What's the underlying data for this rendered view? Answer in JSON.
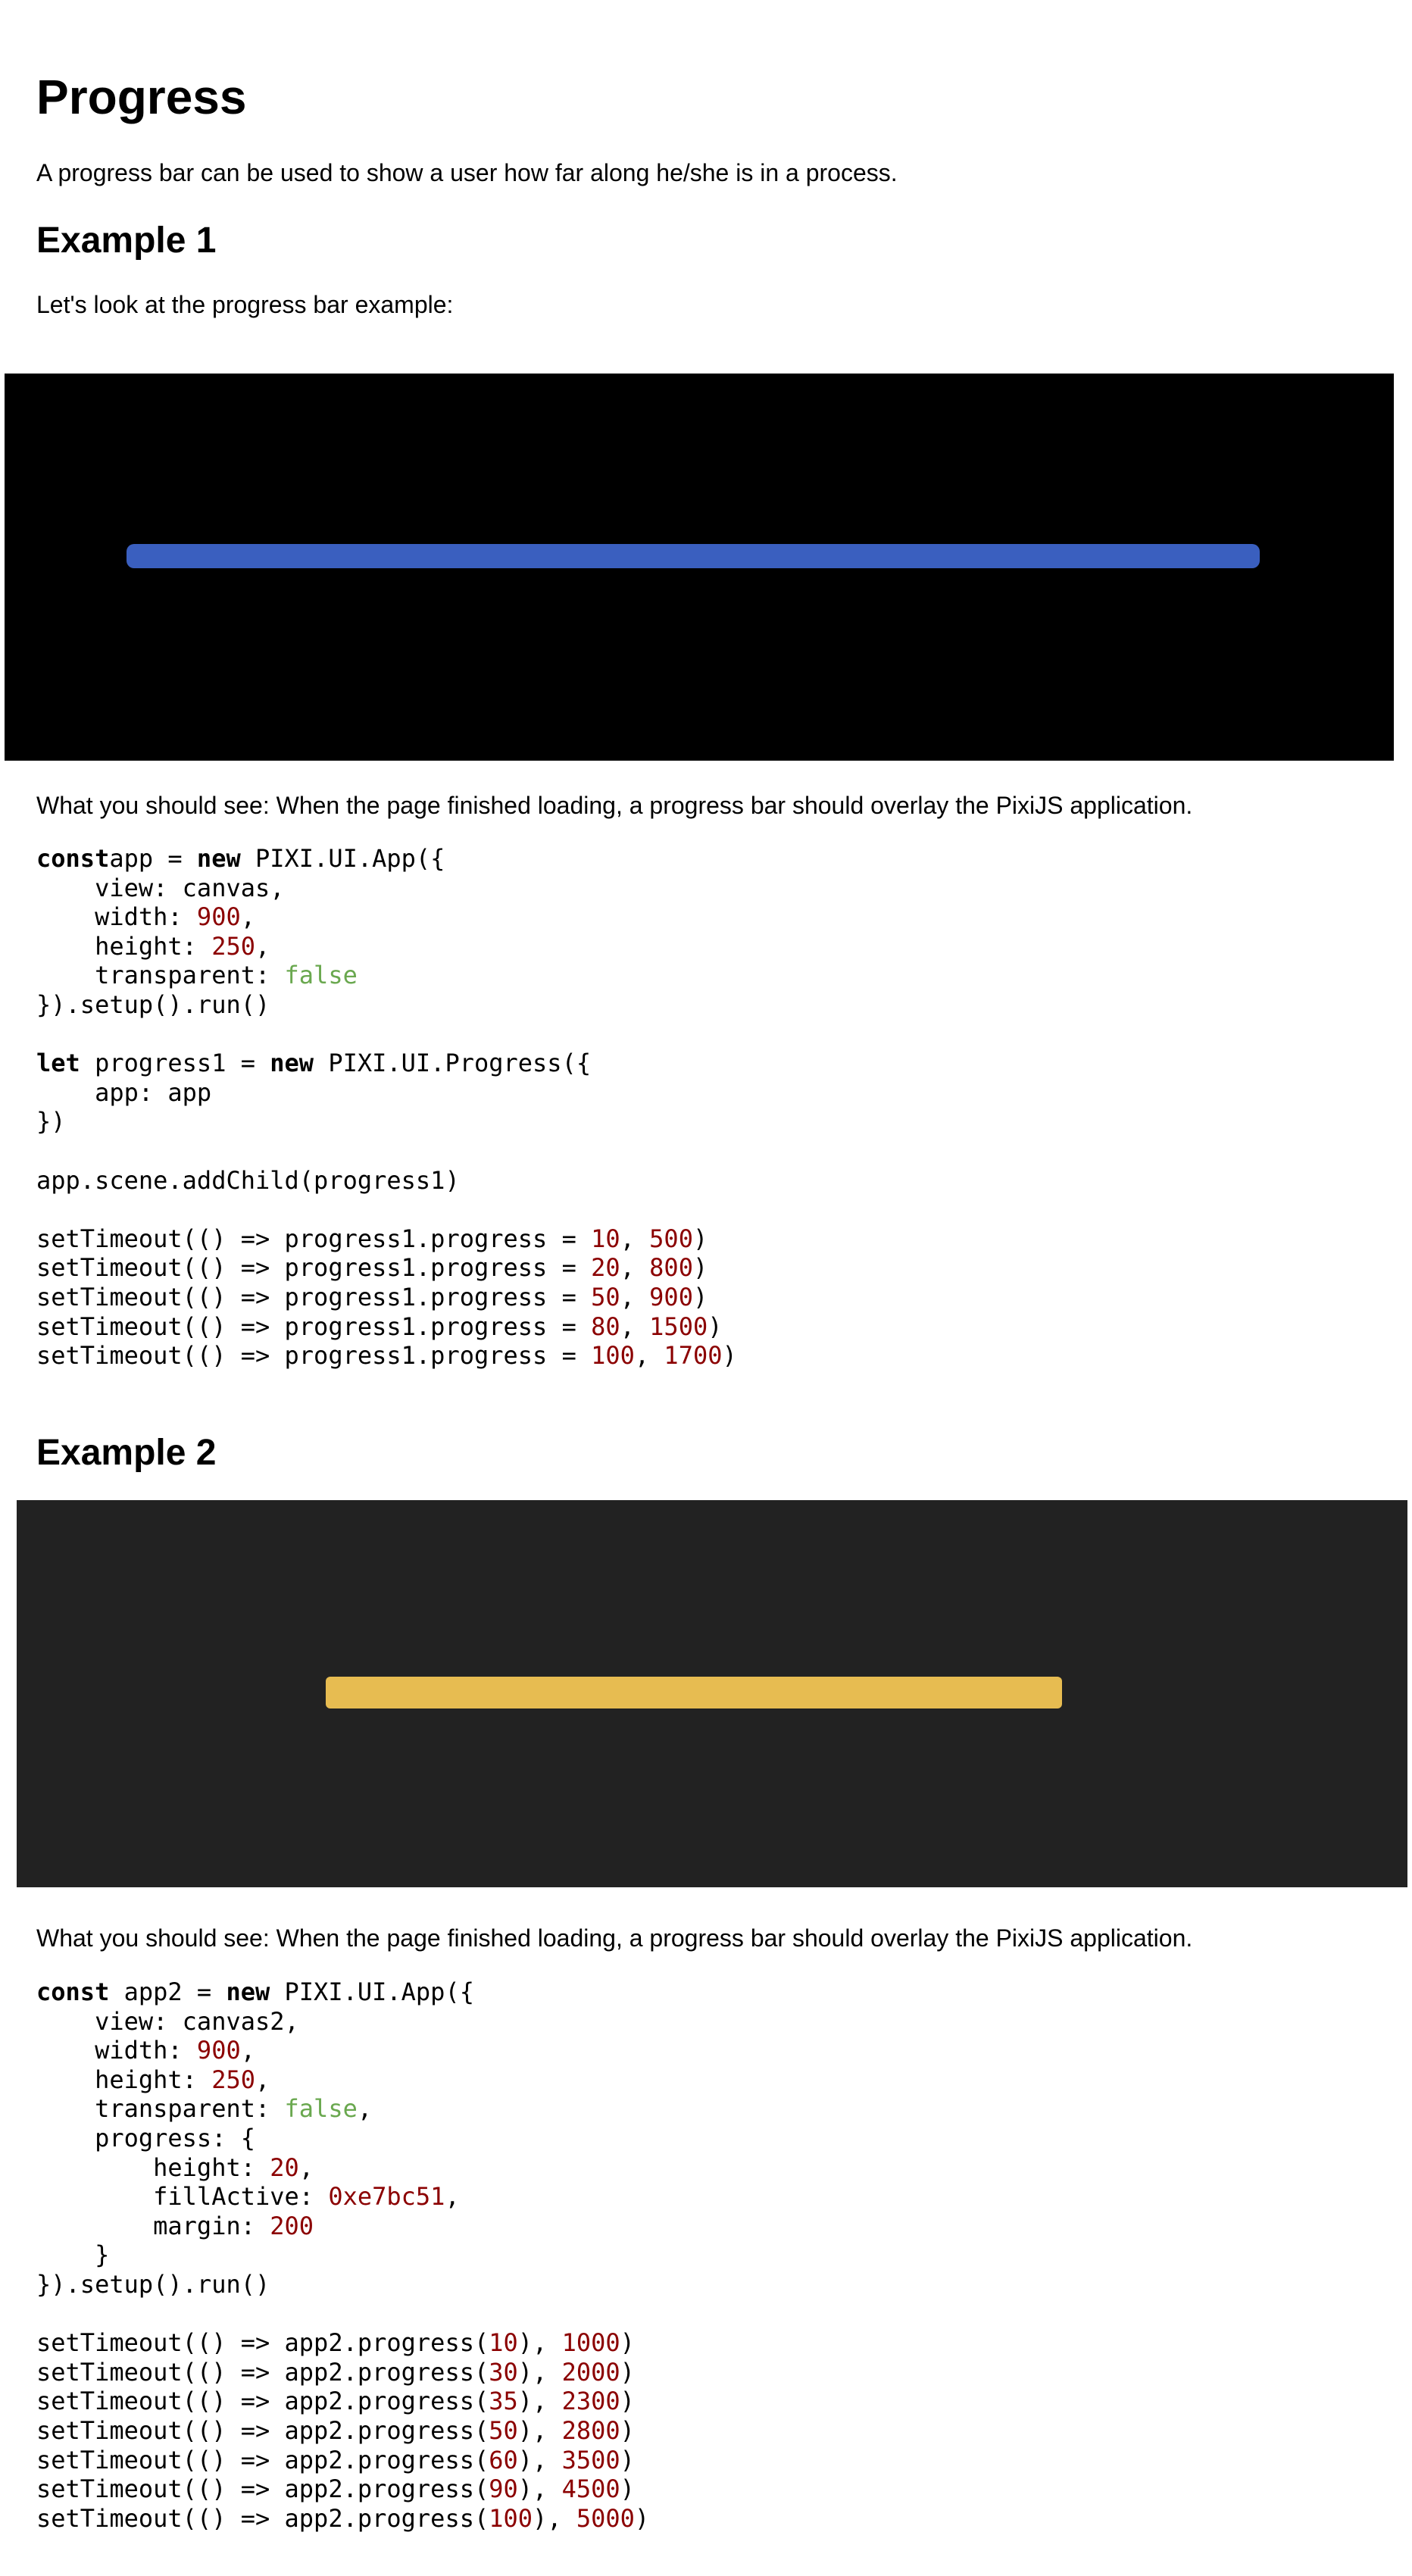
{
  "title": "Progress",
  "intro": "A progress bar can be used to show a user how far along he/she is in a process.",
  "example1": {
    "heading": "Example 1",
    "lead": "Let's look at the progress bar example:",
    "canvas": {
      "background": "#000000",
      "fill_color": "#3a5fbf",
      "progress": 100
    },
    "caption": "What you should see: When the page finished loading, a progress bar should overlay the PixiJS application.",
    "code": [
      [
        [
          "kw",
          "const"
        ],
        [
          "",
          "app = "
        ],
        [
          "kw",
          "new"
        ],
        [
          "",
          " PIXI.UI.App({"
        ]
      ],
      [
        [
          "",
          "    view: canvas,"
        ]
      ],
      [
        [
          "",
          "    width: "
        ],
        [
          "num",
          "900"
        ],
        [
          "",
          ","
        ]
      ],
      [
        [
          "",
          "    height: "
        ],
        [
          "num",
          "250"
        ],
        [
          "",
          ","
        ]
      ],
      [
        [
          "",
          "    transparent: "
        ],
        [
          "bool",
          "false"
        ]
      ],
      [
        [
          "",
          "}).setup().run()"
        ]
      ],
      [
        [
          "",
          ""
        ]
      ],
      [
        [
          "kw",
          "let"
        ],
        [
          "",
          " progress1 = "
        ],
        [
          "kw",
          "new"
        ],
        [
          "",
          " PIXI.UI.Progress({"
        ]
      ],
      [
        [
          "",
          "    app: app"
        ]
      ],
      [
        [
          "",
          "})"
        ]
      ],
      [
        [
          "",
          ""
        ]
      ],
      [
        [
          "",
          "app.scene.addChild(progress1)"
        ]
      ],
      [
        [
          "",
          ""
        ]
      ],
      [
        [
          "",
          "setTimeout(() => progress1.progress = "
        ],
        [
          "num",
          "10"
        ],
        [
          "",
          ", "
        ],
        [
          "num",
          "500"
        ],
        [
          "",
          ")"
        ]
      ],
      [
        [
          "",
          "setTimeout(() => progress1.progress = "
        ],
        [
          "num",
          "20"
        ],
        [
          "",
          ", "
        ],
        [
          "num",
          "800"
        ],
        [
          "",
          ")"
        ]
      ],
      [
        [
          "",
          "setTimeout(() => progress1.progress = "
        ],
        [
          "num",
          "50"
        ],
        [
          "",
          ", "
        ],
        [
          "num",
          "900"
        ],
        [
          "",
          ")"
        ]
      ],
      [
        [
          "",
          "setTimeout(() => progress1.progress = "
        ],
        [
          "num",
          "80"
        ],
        [
          "",
          ", "
        ],
        [
          "num",
          "1500"
        ],
        [
          "",
          ")"
        ]
      ],
      [
        [
          "",
          "setTimeout(() => progress1.progress = "
        ],
        [
          "num",
          "100"
        ],
        [
          "",
          ", "
        ],
        [
          "num",
          "1700"
        ],
        [
          "",
          ")"
        ]
      ]
    ]
  },
  "example2": {
    "heading": "Example 2",
    "canvas": {
      "background": "#222222",
      "fill_color": "#e7bc51",
      "progress": 100
    },
    "caption": "What you should see: When the page finished loading, a progress bar should overlay the PixiJS application.",
    "code": [
      [
        [
          "kw",
          "const"
        ],
        [
          "",
          " app2 = "
        ],
        [
          "kw",
          "new"
        ],
        [
          "",
          " PIXI.UI.App({"
        ]
      ],
      [
        [
          "",
          "    view: canvas2,"
        ]
      ],
      [
        [
          "",
          "    width: "
        ],
        [
          "num",
          "900"
        ],
        [
          "",
          ","
        ]
      ],
      [
        [
          "",
          "    height: "
        ],
        [
          "num",
          "250"
        ],
        [
          "",
          ","
        ]
      ],
      [
        [
          "",
          "    transparent: "
        ],
        [
          "bool",
          "false"
        ],
        [
          "",
          ","
        ]
      ],
      [
        [
          "",
          "    progress: {"
        ]
      ],
      [
        [
          "",
          "        height: "
        ],
        [
          "num",
          "20"
        ],
        [
          "",
          ","
        ]
      ],
      [
        [
          "",
          "        fillActive: "
        ],
        [
          "num",
          "0xe7bc51"
        ],
        [
          "",
          ","
        ]
      ],
      [
        [
          "",
          "        margin: "
        ],
        [
          "num",
          "200"
        ]
      ],
      [
        [
          "",
          "    }"
        ]
      ],
      [
        [
          "",
          "}).setup().run()"
        ]
      ],
      [
        [
          "",
          ""
        ]
      ],
      [
        [
          "",
          "setTimeout(() => app2.progress("
        ],
        [
          "num",
          "10"
        ],
        [
          "",
          "), "
        ],
        [
          "num",
          "1000"
        ],
        [
          "",
          ")"
        ]
      ],
      [
        [
          "",
          "setTimeout(() => app2.progress("
        ],
        [
          "num",
          "30"
        ],
        [
          "",
          "), "
        ],
        [
          "num",
          "2000"
        ],
        [
          "",
          ")"
        ]
      ],
      [
        [
          "",
          "setTimeout(() => app2.progress("
        ],
        [
          "num",
          "35"
        ],
        [
          "",
          "), "
        ],
        [
          "num",
          "2300"
        ],
        [
          "",
          ")"
        ]
      ],
      [
        [
          "",
          "setTimeout(() => app2.progress("
        ],
        [
          "num",
          "50"
        ],
        [
          "",
          "), "
        ],
        [
          "num",
          "2800"
        ],
        [
          "",
          ")"
        ]
      ],
      [
        [
          "",
          "setTimeout(() => app2.progress("
        ],
        [
          "num",
          "60"
        ],
        [
          "",
          "), "
        ],
        [
          "num",
          "3500"
        ],
        [
          "",
          ")"
        ]
      ],
      [
        [
          "",
          "setTimeout(() => app2.progress("
        ],
        [
          "num",
          "90"
        ],
        [
          "",
          "), "
        ],
        [
          "num",
          "4500"
        ],
        [
          "",
          ")"
        ]
      ],
      [
        [
          "",
          "setTimeout(() => app2.progress("
        ],
        [
          "num",
          "100"
        ],
        [
          "",
          "), "
        ],
        [
          "num",
          "5000"
        ],
        [
          "",
          ")"
        ]
      ]
    ]
  }
}
